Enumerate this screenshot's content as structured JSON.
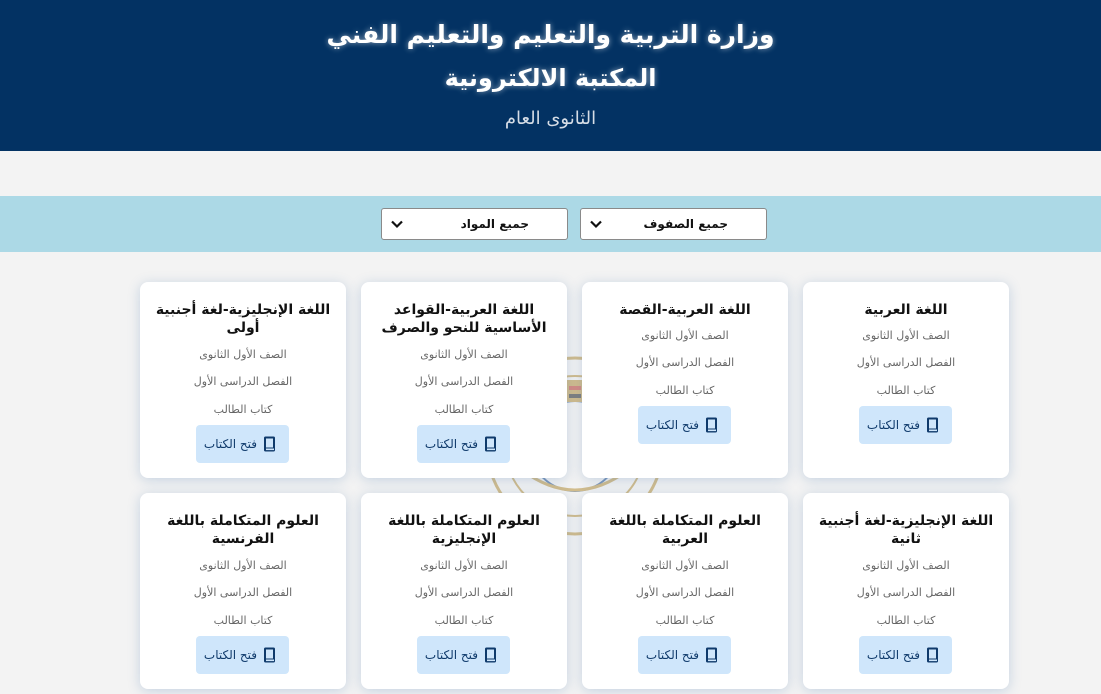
{
  "header": {
    "title_line1": "وزارة التربية والتعليم والتعليم الفني",
    "title_line2": "المكتبة الالكترونية",
    "subtitle": "الثانوى العام"
  },
  "filters": {
    "grade_selected": "جميع الصفوف",
    "subject_selected": "جميع المواد"
  },
  "colors": {
    "header_bg": "#033263",
    "filter_bar_bg": "#acd9e6",
    "button_bg": "#cfe6fb",
    "accent": "#1a5fb4"
  },
  "open_button_label": "فتح الكتاب",
  "books": [
    {
      "title_lines": [
        "اللغة العربية"
      ],
      "grade": "الصف الأول الثانوى",
      "term": "الفصل الدراسى الأول",
      "type": "كتاب الطالب"
    },
    {
      "title_lines": [
        "اللغة العربية-القصة"
      ],
      "grade": "الصف الأول الثانوى",
      "term": "الفصل الدراسى الأول",
      "type": "كتاب الطالب"
    },
    {
      "title_lines": [
        "اللغة العربية-القواعد",
        "الأساسية للنحو والصرف"
      ],
      "grade": "الصف الأول الثانوى",
      "term": "الفصل الدراسى الأول",
      "type": "كتاب الطالب"
    },
    {
      "title_lines": [
        "اللغة الإنجليزية-لغة أجنبية",
        "أولى"
      ],
      "grade": "الصف الأول الثانوى",
      "term": "الفصل الدراسى الأول",
      "type": "كتاب الطالب"
    },
    {
      "title_lines": [
        "اللغة الإنجليزية-لغة أجنبية",
        "ثانية"
      ],
      "grade": "الصف الأول الثانوى",
      "term": "الفصل الدراسى الأول",
      "type": "كتاب الطالب"
    },
    {
      "title_lines": [
        "العلوم المتكاملة باللغة",
        "العربية"
      ],
      "grade": "الصف الأول الثانوى",
      "term": "الفصل الدراسى الأول",
      "type": "كتاب الطالب"
    },
    {
      "title_lines": [
        "العلوم المتكاملة باللغة",
        "الإنجليزية"
      ],
      "grade": "الصف الأول الثانوى",
      "term": "الفصل الدراسى الأول",
      "type": "كتاب الطالب"
    },
    {
      "title_lines": [
        "العلوم المتكاملة باللغة",
        "الفرنسية"
      ],
      "grade": "الصف الأول الثانوى",
      "term": "الفصل الدراسى الأول",
      "type": "كتاب الطالب"
    }
  ]
}
